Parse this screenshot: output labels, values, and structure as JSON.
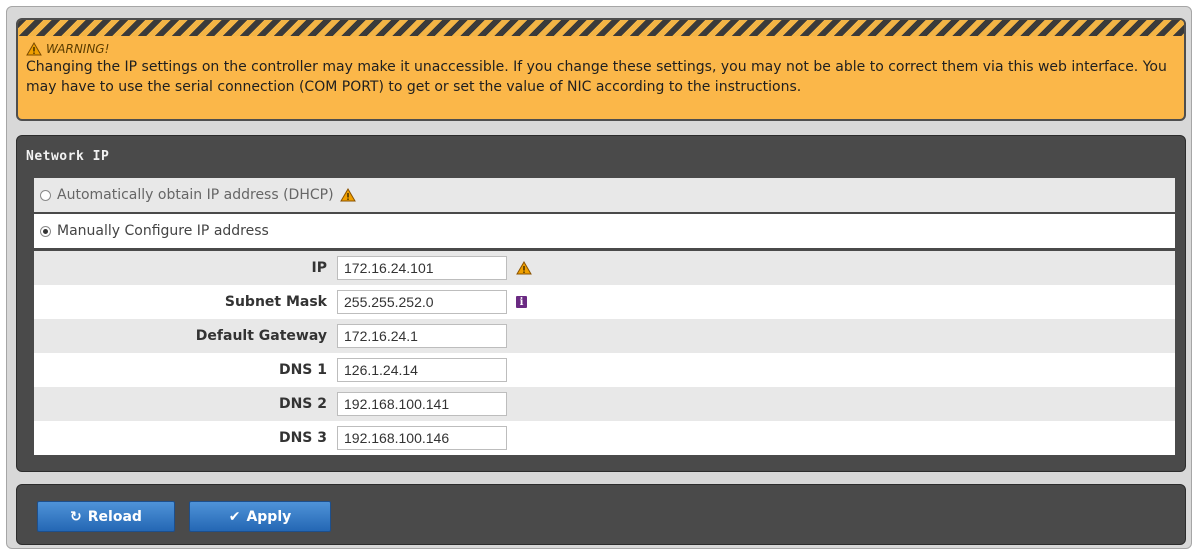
{
  "warning": {
    "title": "WARNING!",
    "message": "Changing the IP settings on the controller may make it unaccessible. If you change these settings, you may not be able to correct them via this web interface. You may have to use the serial connection (COM PORT) to get or set the value of NIC according to the instructions."
  },
  "panel": {
    "title": "Network IP",
    "options": [
      {
        "label": "Automatically obtain IP address (DHCP)",
        "selected": false
      },
      {
        "label": "Manually Configure IP address",
        "selected": true
      }
    ],
    "fields": [
      {
        "label": "IP",
        "value": "172.16.24.101",
        "icon": "warning-icon"
      },
      {
        "label": "Subnet Mask",
        "value": "255.255.252.0",
        "icon": "info-icon"
      },
      {
        "label": "Default Gateway",
        "value": "172.16.24.1"
      },
      {
        "label": "DNS 1",
        "value": "126.1.24.14"
      },
      {
        "label": "DNS 2",
        "value": "192.168.100.141"
      },
      {
        "label": "DNS 3",
        "value": "192.168.100.146"
      }
    ]
  },
  "buttons": {
    "reload": "Reload",
    "apply": "Apply"
  },
  "colors": {
    "warning_bg": "#fbb749",
    "panel_bg": "#4a4a4a",
    "button_blue": "#2f72c0",
    "info_purple": "#6a2a82"
  }
}
